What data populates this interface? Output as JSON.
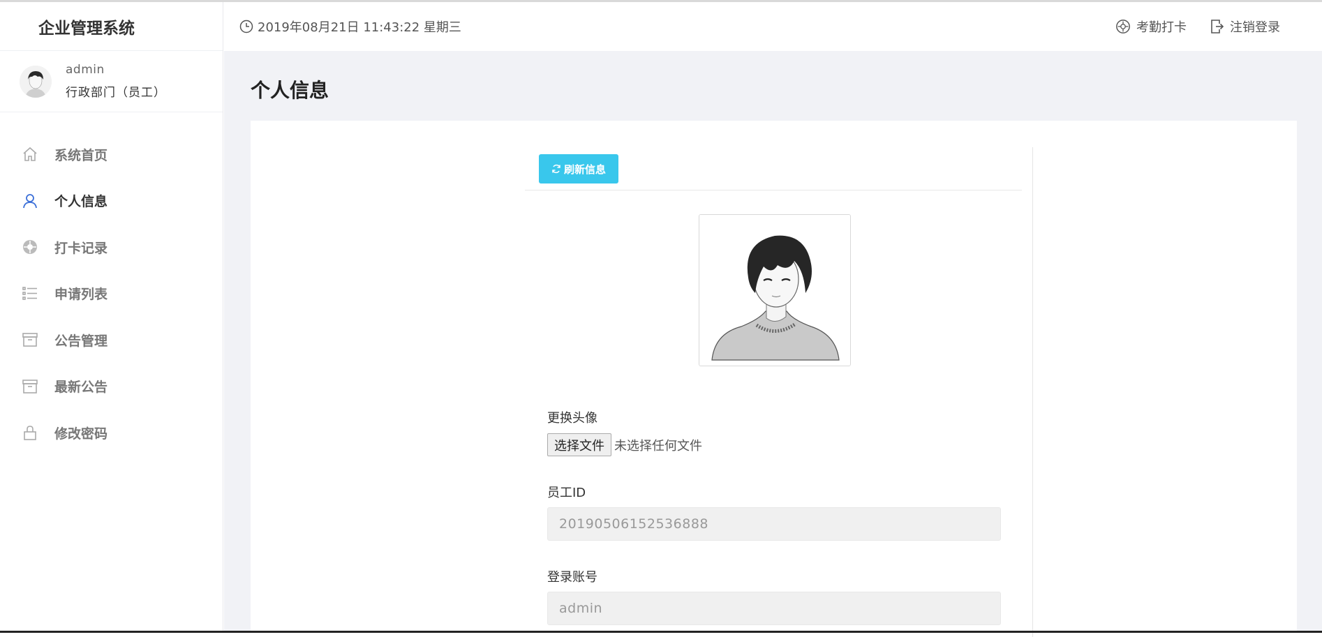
{
  "app": {
    "brand": "企业管理系统"
  },
  "user": {
    "name": "admin",
    "dept": "行政部门（员工）"
  },
  "sidebar": {
    "items": [
      {
        "label": "系统首页",
        "icon": "home-icon"
      },
      {
        "label": "个人信息",
        "icon": "user-icon",
        "active": true
      },
      {
        "label": "打卡记录",
        "icon": "clock-in-icon"
      },
      {
        "label": "申请列表",
        "icon": "list-icon"
      },
      {
        "label": "公告管理",
        "icon": "archive-icon"
      },
      {
        "label": "最新公告",
        "icon": "archive-icon"
      },
      {
        "label": "修改密码",
        "icon": "lock-icon"
      }
    ]
  },
  "header": {
    "datetime": "2019年08月21日 11:43:22 星期三",
    "checkin_label": "考勤打卡",
    "logout_label": "注销登录"
  },
  "page": {
    "title": "个人信息"
  },
  "form": {
    "refresh_label": "刷新信息",
    "avatar_label": "更换头像",
    "file_button_label": "选择文件",
    "file_status": "未选择任何文件",
    "employee_id_label": "员工ID",
    "employee_id_value": "20190506152536888",
    "account_label": "登录账号",
    "account_value": "admin"
  },
  "colors": {
    "accent": "#39c7ec",
    "active_nav_icon": "#3b6fd8",
    "background": "#f1f2f6"
  }
}
